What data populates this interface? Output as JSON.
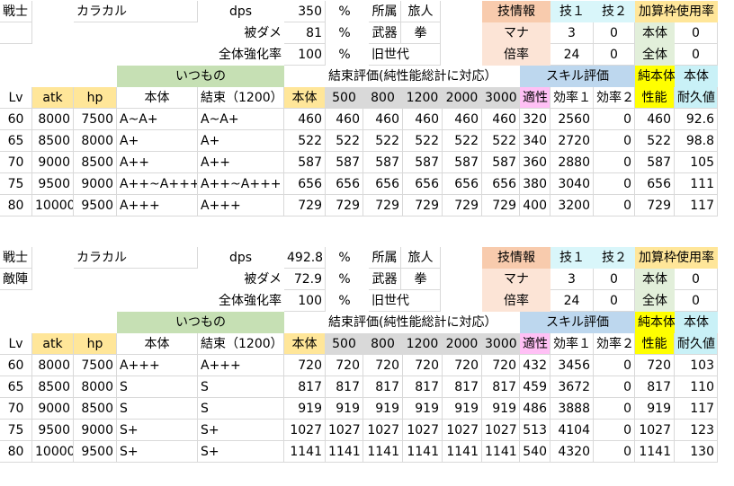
{
  "blocks": [
    {
      "class_label": "戦士",
      "name": "カラカル",
      "sub_label": "",
      "dps_label": "dps",
      "dps_value": "350",
      "taken_label": "被ダメ",
      "taken_value": "81",
      "boost_label": "全体強化率",
      "boost_value": "100",
      "pct": "%",
      "affil_label": "所属",
      "affil_value": "旅人",
      "weapon_label": "武器",
      "weapon_value": "拳",
      "gen_label": "旧世代",
      "skillinfo_label": "技情報",
      "skill1_label": "技１",
      "skill2_label": "技２",
      "addrate_label": "加算枠使用率",
      "mana_label": "マナ",
      "mana_s1": "3",
      "mana_s2": "0",
      "main_label": "本体",
      "main_val": "0",
      "mult_label": "倍率",
      "mult_s1": "24",
      "mult_s2": "0",
      "all_label": "全体",
      "all_val": "0",
      "itsumono": "いつもの",
      "kessoku_eval": "結束評価(純性能総計に対応）",
      "skill_eval": "スキル評価",
      "pure_label": "純本体",
      "hontai_label": "本体",
      "headers": {
        "lv": "Lv",
        "atk": "atk",
        "hp": "hp",
        "body": "本体",
        "bond": "結束（1200）",
        "body2": "本体",
        "b500": "500",
        "b800": "800",
        "b1200": "1200",
        "b2000": "2000",
        "b3000": "3000",
        "fit": "適性",
        "eff1": "効率１",
        "eff2": "効率２",
        "perf": "性能",
        "dur": "耐久値"
      },
      "rows": [
        [
          "60",
          "8000",
          "7500",
          "A~A+",
          "A~A+",
          "460",
          "460",
          "460",
          "460",
          "460",
          "460",
          "320",
          "2560",
          "0",
          "460",
          "92.6"
        ],
        [
          "65",
          "8500",
          "8000",
          "A+",
          "A+",
          "522",
          "522",
          "522",
          "522",
          "522",
          "522",
          "340",
          "2720",
          "0",
          "522",
          "98.8"
        ],
        [
          "70",
          "9000",
          "8500",
          "A++",
          "A++",
          "587",
          "587",
          "587",
          "587",
          "587",
          "587",
          "360",
          "2880",
          "0",
          "587",
          "105"
        ],
        [
          "75",
          "9500",
          "9000",
          "A++~A+++",
          "A++~A+++",
          "656",
          "656",
          "656",
          "656",
          "656",
          "656",
          "380",
          "3040",
          "0",
          "656",
          "111"
        ],
        [
          "80",
          "10000",
          "9500",
          "A+++",
          "A+++",
          "729",
          "729",
          "729",
          "729",
          "729",
          "729",
          "400",
          "3200",
          "0",
          "729",
          "117"
        ]
      ]
    },
    {
      "class_label": "戦士",
      "name": "カラカル",
      "sub_label": "敵陣",
      "dps_label": "dps",
      "dps_value": "492.8",
      "taken_label": "被ダメ",
      "taken_value": "72.9",
      "boost_label": "全体強化率",
      "boost_value": "100",
      "pct": "%",
      "affil_label": "所属",
      "affil_value": "旅人",
      "weapon_label": "武器",
      "weapon_value": "拳",
      "gen_label": "旧世代",
      "skillinfo_label": "技情報",
      "skill1_label": "技１",
      "skill2_label": "技２",
      "addrate_label": "加算枠使用率",
      "mana_label": "マナ",
      "mana_s1": "3",
      "mana_s2": "0",
      "main_label": "本体",
      "main_val": "0",
      "mult_label": "倍率",
      "mult_s1": "24",
      "mult_s2": "0",
      "all_label": "全体",
      "all_val": "0",
      "itsumono": "いつもの",
      "kessoku_eval": "結束評価(純性能総計に対応）",
      "skill_eval": "スキル評価",
      "pure_label": "純本体",
      "hontai_label": "本体",
      "headers": {
        "lv": "Lv",
        "atk": "atk",
        "hp": "hp",
        "body": "本体",
        "bond": "結束（1200）",
        "body2": "本体",
        "b500": "500",
        "b800": "800",
        "b1200": "1200",
        "b2000": "2000",
        "b3000": "3000",
        "fit": "適性",
        "eff1": "効率１",
        "eff2": "効率２",
        "perf": "性能",
        "dur": "耐久値"
      },
      "rows": [
        [
          "60",
          "8000",
          "7500",
          "A+++",
          "A+++",
          "720",
          "720",
          "720",
          "720",
          "720",
          "720",
          "432",
          "3456",
          "0",
          "720",
          "103"
        ],
        [
          "65",
          "8500",
          "8000",
          "S",
          "S",
          "817",
          "817",
          "817",
          "817",
          "817",
          "817",
          "459",
          "3672",
          "0",
          "817",
          "110"
        ],
        [
          "70",
          "9000",
          "8500",
          "S",
          "S",
          "919",
          "919",
          "919",
          "919",
          "919",
          "919",
          "486",
          "3888",
          "0",
          "919",
          "117"
        ],
        [
          "75",
          "9500",
          "9000",
          "S+",
          "S+",
          "1027",
          "1027",
          "1027",
          "1027",
          "1027",
          "1027",
          "513",
          "4104",
          "0",
          "1027",
          "123"
        ],
        [
          "80",
          "10000",
          "9500",
          "S+",
          "S+",
          "1141",
          "1141",
          "1141",
          "1141",
          "1141",
          "1141",
          "540",
          "4320",
          "0",
          "1141",
          "130"
        ]
      ]
    }
  ]
}
